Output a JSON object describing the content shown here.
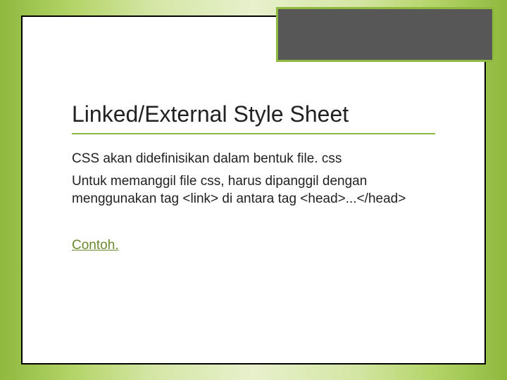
{
  "slide": {
    "title": "Linked/External Style Sheet",
    "paragraph1": "CSS akan didefinisikan dalam bentuk file. css",
    "paragraph2": "Untuk memanggil file css, harus dipanggil dengan menggunakan tag <link> di antara tag <head>...</head>",
    "link_label": "Contoh."
  }
}
